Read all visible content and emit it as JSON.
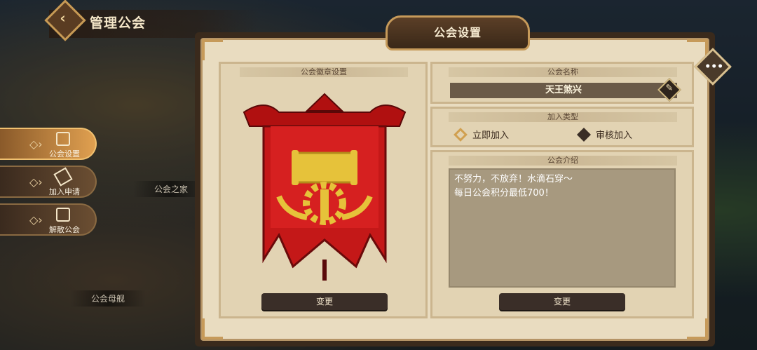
{
  "header": {
    "back_icon": "chevron-left",
    "title": "管理公会"
  },
  "sidebar": {
    "items": [
      {
        "label": "公会设置",
        "icon": "guild-settings-icon",
        "active": true
      },
      {
        "label": "加入申请",
        "icon": "gavel-icon",
        "active": false
      },
      {
        "label": "解散公会",
        "icon": "disband-icon",
        "active": false
      }
    ]
  },
  "map_labels": {
    "guild_home": "公会之家",
    "mothership": "公会母舰"
  },
  "panel": {
    "title": "公会设置",
    "emblem": {
      "header": "公会徽章设置",
      "change_label": "变更"
    },
    "name": {
      "header": "公会名称",
      "value": "天王煞兴"
    },
    "join_type": {
      "header": "加入类型",
      "options": [
        {
          "label": "立即加入",
          "selected": true
        },
        {
          "label": "审核加入",
          "selected": false
        }
      ]
    },
    "intro": {
      "header": "公会介绍",
      "text": "不努力，不放弃！水滴石穿～\n每日公会积分最低700！",
      "change_label": "变更"
    }
  },
  "colors": {
    "accent": "#c69a5a",
    "banner_red": "#c41818",
    "banner_gold": "#e6c23a"
  }
}
